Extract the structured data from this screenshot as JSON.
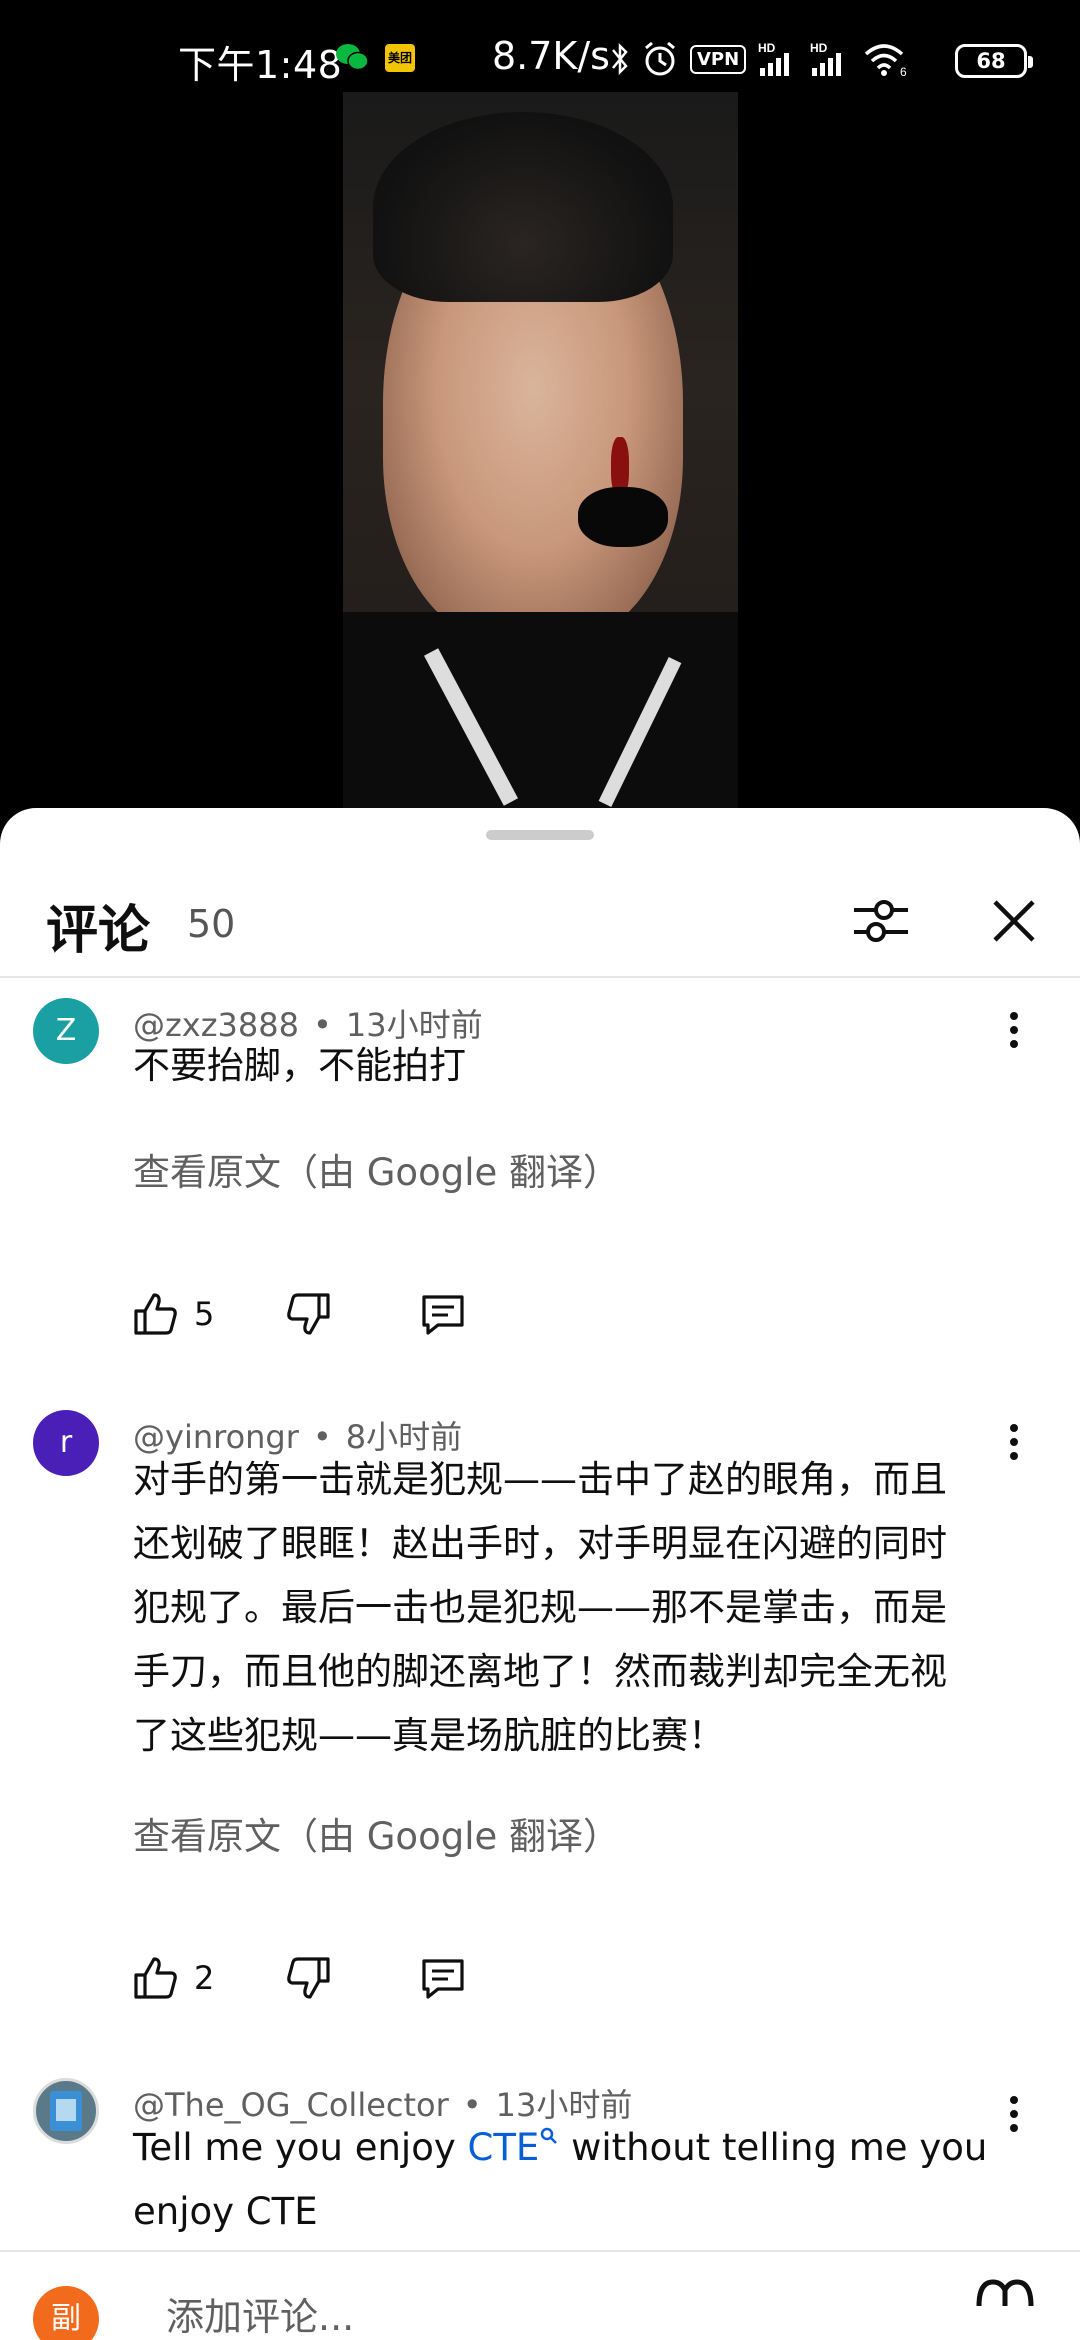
{
  "status": {
    "time": "下午1:48",
    "app_badge": "美团",
    "net_speed": "8.7K/s",
    "vpn": "VPN",
    "signal1": "HD",
    "signal2": "HD",
    "wifi_badge": "6",
    "battery": "68"
  },
  "sheet": {
    "title": "评论",
    "count": "50"
  },
  "comments": [
    {
      "avatar_letter": "Z",
      "avatar_color": "#1a9fa3",
      "author": "@zxz3888",
      "time": "13小时前",
      "text": "不要抬脚，不能拍打",
      "translate": "查看原文（由 Google 翻译）",
      "likes": "5"
    },
    {
      "avatar_letter": "r",
      "avatar_color": "#4a1fb8",
      "author": "@yinrongr",
      "time": "8小时前",
      "lines": [
        "对手的第一击就是犯规——击中了赵的眼角，而且",
        "还划破了眼眶！赵出手时，对手明显在闪避的同时",
        "犯规了。最后一击也是犯规——那不是掌击，而是",
        "手刀，而且他的脚还离地了！然而裁判却完全无视",
        "了这些犯规——真是场肮脏的比赛！"
      ],
      "translate": "查看原文（由 Google 翻译）",
      "likes": "2"
    },
    {
      "avatar_color": "#5a7a8a",
      "author": "@The_OG_Collector",
      "time": "13小时前",
      "text_before": "Tell me you enjoy ",
      "link": "CTE",
      "text_after": " without telling me you",
      "line2": "enjoy CTE"
    }
  ],
  "input": {
    "me_letter": "副",
    "placeholder": "添加评论..."
  },
  "colors": {
    "link": "#065fd4",
    "me_avatar": "#f26b1d"
  }
}
